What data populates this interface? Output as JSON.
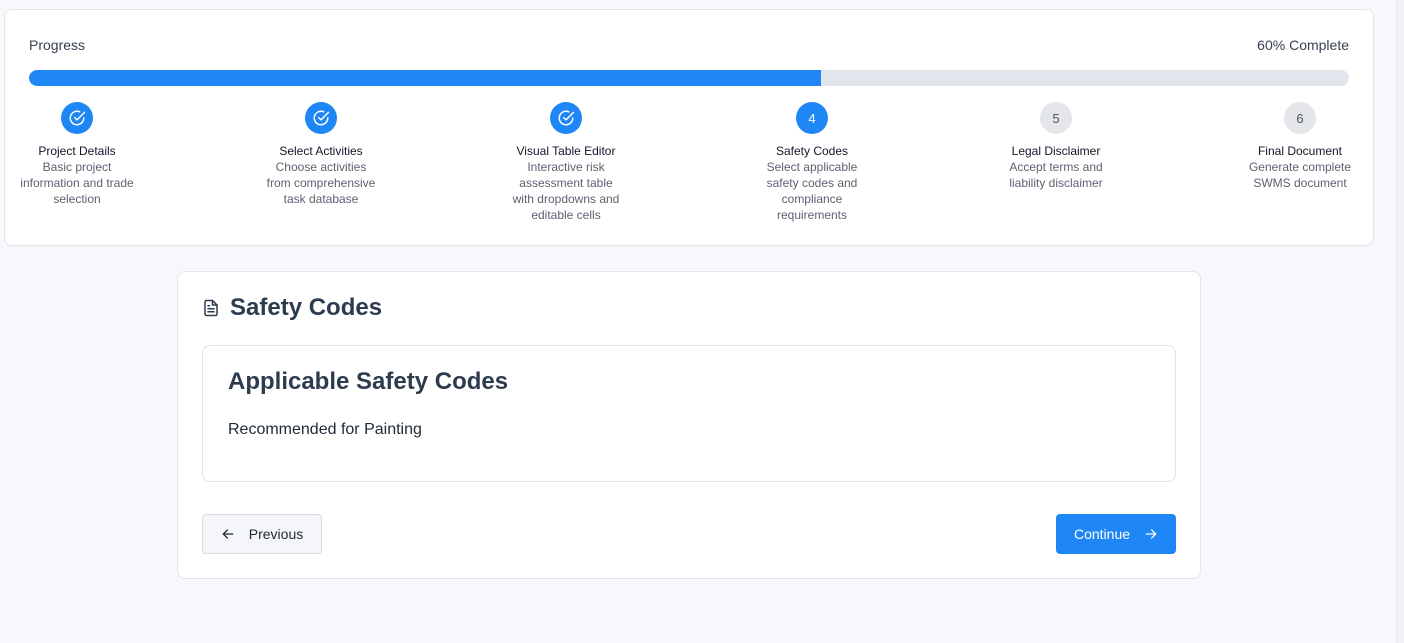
{
  "progress": {
    "label": "Progress",
    "percent_text": "60% Complete",
    "fraction": 0.6,
    "accent_color": "#1f86f5"
  },
  "steps": [
    {
      "number": "1",
      "status": "done",
      "icon": "check-circle-icon",
      "title": "Project Details",
      "desc": "Basic project information and trade selection"
    },
    {
      "number": "2",
      "status": "done",
      "icon": "check-circle-icon",
      "title": "Select Activities",
      "desc": "Choose activities from comprehensive task database"
    },
    {
      "number": "3",
      "status": "done",
      "icon": "check-circle-icon",
      "title": "Visual Table Editor",
      "desc": "Interactive risk assessment table with dropdowns and editable cells"
    },
    {
      "number": "4",
      "status": "current",
      "title": "Safety Codes",
      "desc": "Select applicable safety codes and compliance requirements"
    },
    {
      "number": "5",
      "status": "pending",
      "title": "Legal Disclaimer",
      "desc": "Accept terms and liability disclaimer"
    },
    {
      "number": "6",
      "status": "pending",
      "title": "Final Document",
      "desc": "Generate complete SWMS document"
    }
  ],
  "main": {
    "icon": "document-icon",
    "title": "Safety Codes",
    "section_title": "Applicable Safety Codes",
    "recommended_text": "Recommended for Painting"
  },
  "nav": {
    "previous_label": "Previous",
    "continue_label": "Continue"
  }
}
